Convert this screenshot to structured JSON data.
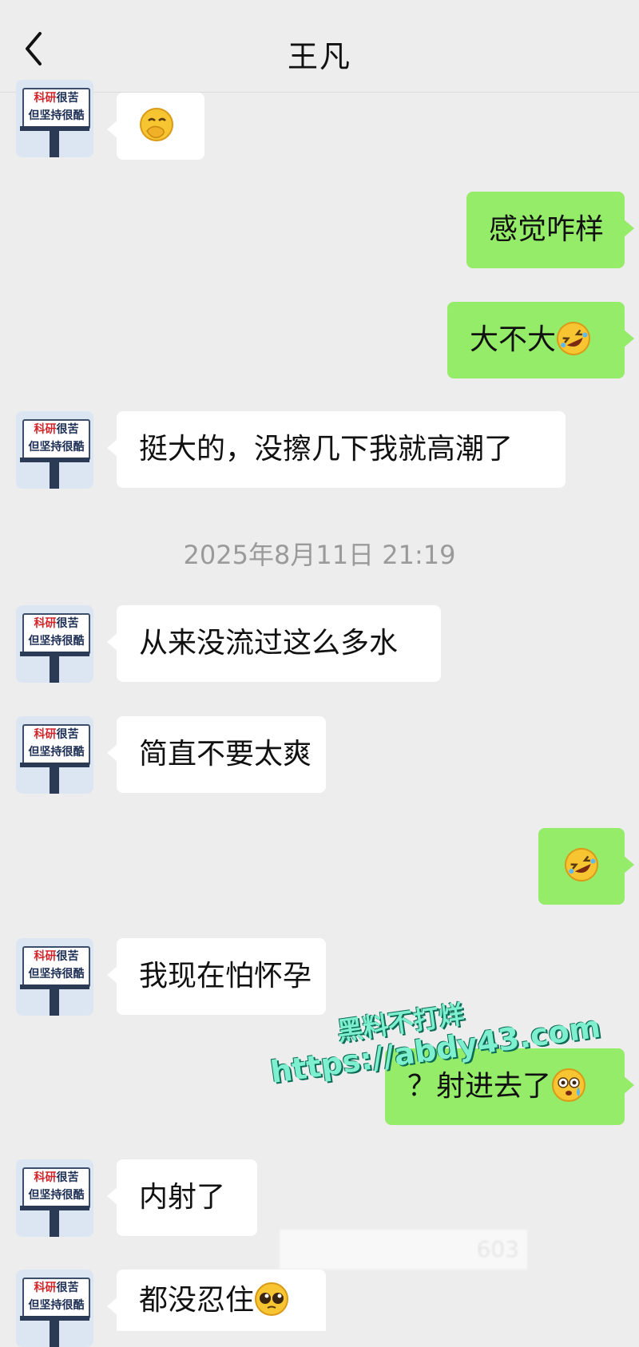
{
  "header": {
    "title": "王凡",
    "back_icon": "chevron-left-icon"
  },
  "avatar": {
    "line1a": "科研",
    "line1b": "很苦",
    "line2": "但坚持很酷"
  },
  "messages": [
    {
      "side": "left",
      "text": "",
      "emoji": "face-with-hand-over-mouth"
    },
    {
      "side": "right",
      "text": "感觉咋样",
      "emoji": ""
    },
    {
      "side": "right",
      "text": "大不大",
      "emoji": "rolling-on-floor-laughing"
    },
    {
      "side": "left",
      "text": "挺大的，没擦几下我就高潮了",
      "emoji": ""
    },
    {
      "side": "left",
      "text": "从来没流过这么多水",
      "emoji": ""
    },
    {
      "side": "left",
      "text": "简直不要太爽",
      "emoji": ""
    },
    {
      "side": "right",
      "text": "",
      "emoji": "rolling-on-floor-laughing"
    },
    {
      "side": "left",
      "text": "我现在怕怀孕",
      "emoji": ""
    },
    {
      "side": "right",
      "text": "？射进去了",
      "emoji": "flushed-face"
    },
    {
      "side": "left",
      "text": "内射了",
      "emoji": ""
    },
    {
      "side": "left",
      "text": "都没忍住",
      "emoji": "pleading-face"
    }
  ],
  "timestamp": "2025年8月11日 21:19",
  "watermark": {
    "line1": "黑料不打烊",
    "line2": "https://abdy43.com"
  },
  "blurred_text": "603"
}
